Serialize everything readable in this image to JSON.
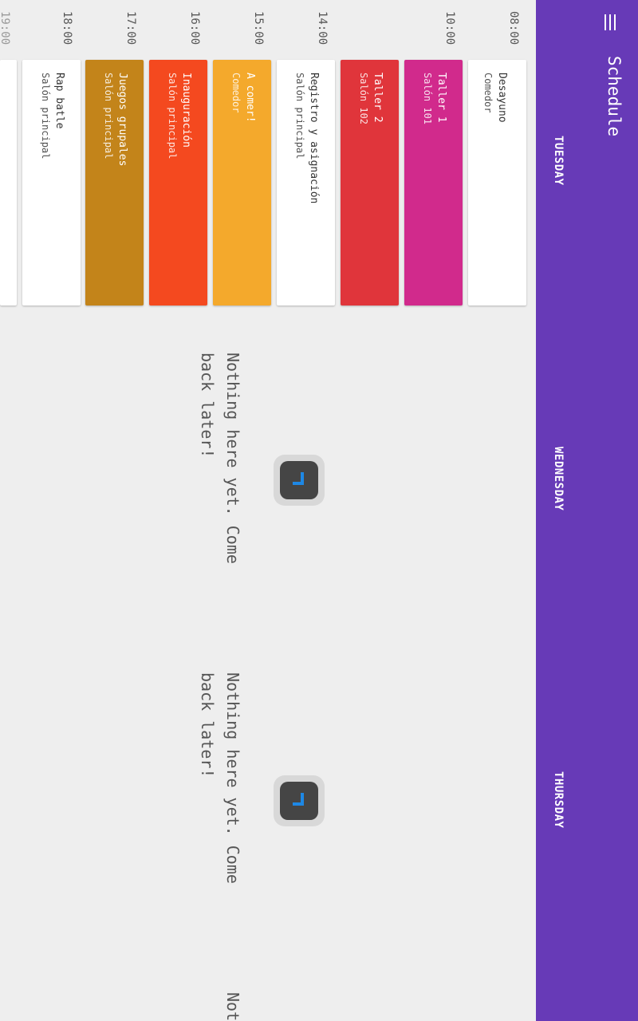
{
  "app_bar": {
    "title": "Schedule",
    "menu_icon": "hamburger-menu-icon",
    "background": "#673ab7"
  },
  "tabs": [
    {
      "label": "TUESDAY"
    },
    {
      "label": "WEDNESDAY"
    },
    {
      "label": "THURSDAY"
    }
  ],
  "times": [
    "08:00",
    "10:00",
    "14:00",
    "15:00",
    "16:00",
    "17:00",
    "18:00",
    "19:00"
  ],
  "sessions": [
    {
      "title": "Desayuno",
      "room": "Comedor",
      "color": "#ffffff",
      "text_color": "#333333"
    },
    {
      "title": "Taller 1",
      "room": "Salón 101",
      "color": "#d12a8c",
      "text_color": "#ffffff"
    },
    {
      "title": "Taller 2",
      "room": "Salón 102",
      "color": "#e0353b",
      "text_color": "#ffffff"
    },
    {
      "title": "Registro y asignación",
      "room": "Salón principal",
      "color": "#ffffff",
      "text_color": "#333333"
    },
    {
      "title": "A comer!",
      "room": "Comedor",
      "color": "#f4a92c",
      "text_color": "#ffffff"
    },
    {
      "title": "Inauguración",
      "room": "Salón principal",
      "color": "#f4491f",
      "text_color": "#ffffff"
    },
    {
      "title": "Juegos grupales",
      "room": "Salón principal",
      "color": "#c3841a",
      "text_color": "#ffffff"
    },
    {
      "title": "Rap batle",
      "room": "Salón principal",
      "color": "#ffffff",
      "text_color": "#333333"
    }
  ],
  "empty_state": {
    "message": "Nothing here yet. Come back later!",
    "icon": "empty-schedule-icon",
    "partial_label": "Not"
  }
}
